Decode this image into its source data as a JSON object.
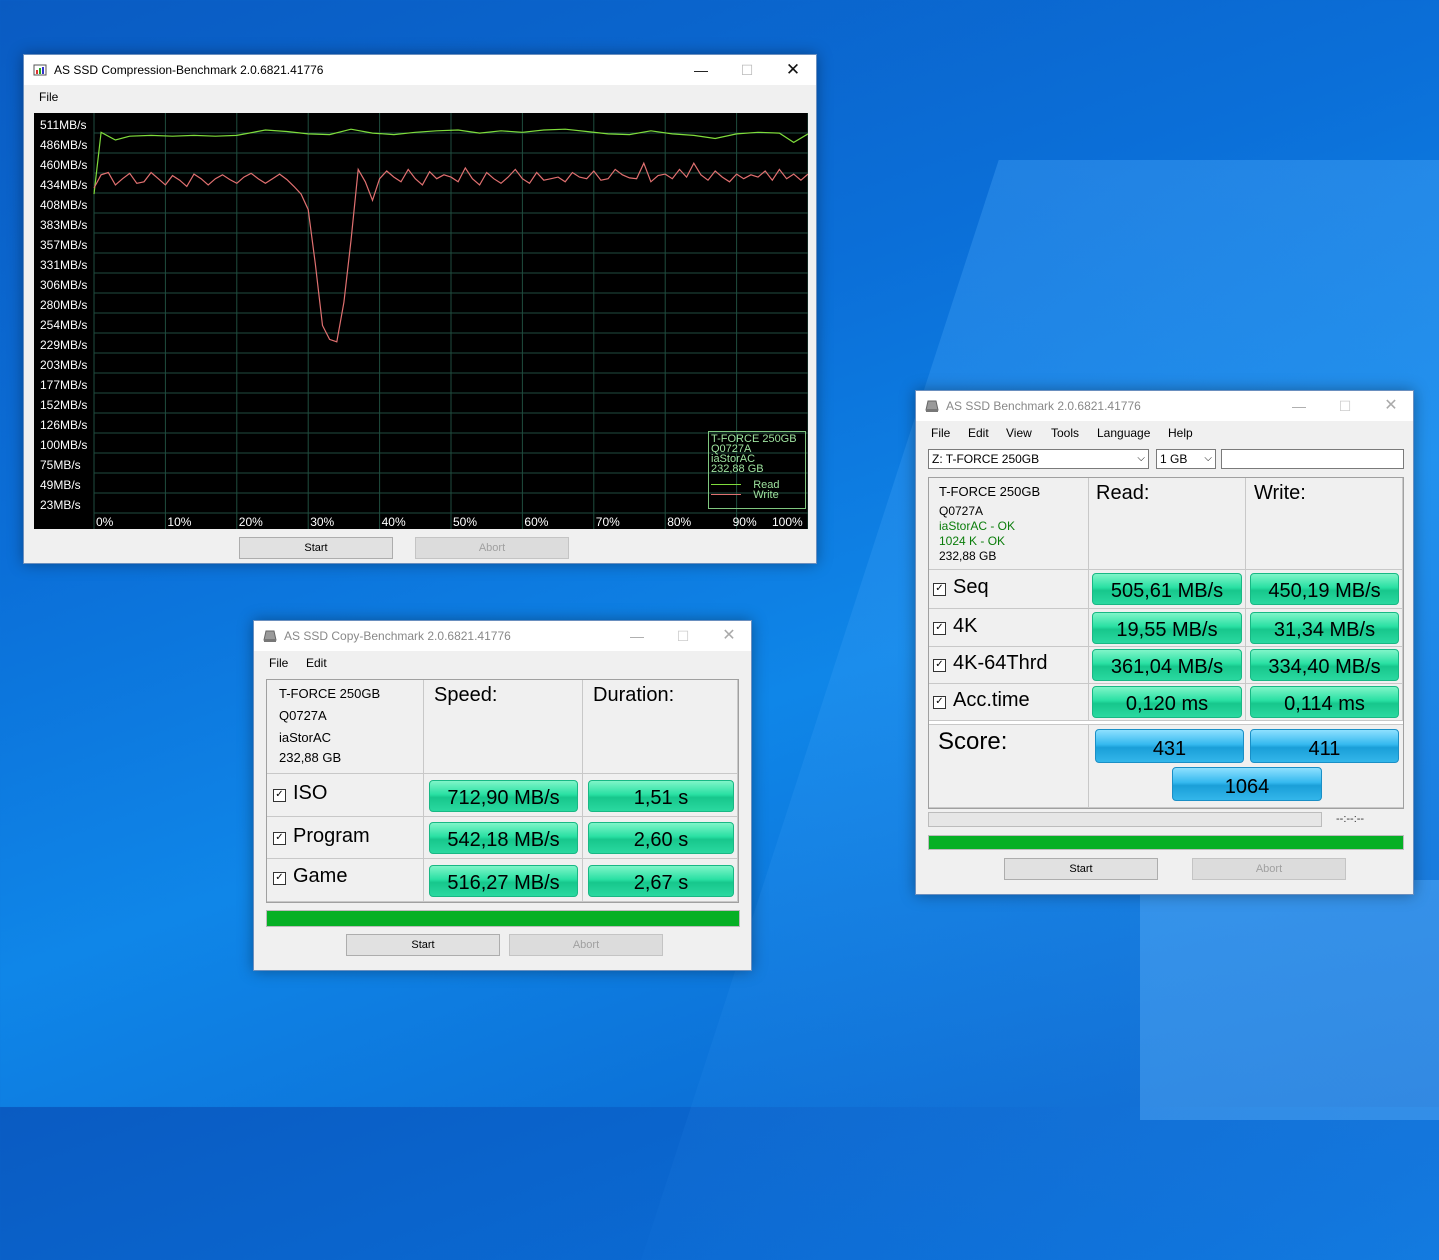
{
  "compression": {
    "title": "AS SSD Compression-Benchmark 2.0.6821.41776",
    "menu": [
      "File"
    ],
    "y_labels": [
      "511MB/s",
      "486MB/s",
      "460MB/s",
      "434MB/s",
      "408MB/s",
      "383MB/s",
      "357MB/s",
      "331MB/s",
      "306MB/s",
      "280MB/s",
      "254MB/s",
      "229MB/s",
      "203MB/s",
      "177MB/s",
      "152MB/s",
      "126MB/s",
      "100MB/s",
      "75MB/s",
      "49MB/s",
      "23MB/s"
    ],
    "x_labels": [
      "0%",
      "10%",
      "20%",
      "30%",
      "40%",
      "50%",
      "60%",
      "70%",
      "80%",
      "90%",
      "100%"
    ],
    "legend": {
      "drive": "T-FORCE 250GB",
      "firmware": "Q0727A",
      "driver": "iaStorAC",
      "size": "232,88 GB",
      "read": "Read",
      "write": "Write"
    },
    "start": "Start",
    "abort": "Abort"
  },
  "chart_data": {
    "type": "line",
    "ylim": [
      10,
      525
    ],
    "xlim": [
      0,
      100
    ],
    "grid": true,
    "legend_position": "bottom-right",
    "series": [
      {
        "name": "Read",
        "color": "#7fdc3c",
        "x": [
          0,
          1,
          3,
          5,
          8,
          11,
          14,
          17,
          20,
          24,
          27,
          30,
          33,
          36,
          39,
          42,
          45,
          48,
          51,
          54,
          57,
          60,
          63,
          66,
          69,
          72,
          75,
          78,
          81,
          84,
          87,
          90,
          93,
          96,
          98,
          100
        ],
        "y": [
          420,
          500,
          490,
          495,
          496,
          495,
          496,
          495,
          496,
          503,
          501,
          498,
          497,
          504,
          499,
          497,
          500,
          502,
          503,
          499,
          502,
          500,
          503,
          504,
          501,
          498,
          497,
          502,
          498,
          496,
          492,
          498,
          500,
          499,
          487,
          498
        ]
      },
      {
        "name": "Write",
        "color": "#e07070",
        "x": [
          0,
          1,
          2,
          3,
          4,
          5,
          6,
          7,
          8,
          9,
          10,
          11,
          12,
          13,
          14,
          15,
          16,
          17,
          18,
          19,
          20,
          21,
          22,
          23,
          24,
          25,
          26,
          27,
          28,
          29,
          30,
          31,
          32,
          33,
          34,
          35,
          36,
          37,
          38,
          39,
          40,
          41,
          42,
          43,
          44,
          45,
          46,
          47,
          48,
          49,
          50,
          51,
          52,
          53,
          54,
          55,
          56,
          57,
          58,
          59,
          60,
          61,
          62,
          63,
          64,
          65,
          66,
          67,
          68,
          69,
          70,
          71,
          72,
          73,
          74,
          75,
          76,
          77,
          78,
          79,
          80,
          81,
          82,
          83,
          84,
          85,
          86,
          87,
          88,
          89,
          90,
          91,
          92,
          93,
          94,
          95,
          96,
          97,
          98,
          99,
          100
        ],
        "y": [
          428,
          445,
          448,
          432,
          440,
          447,
          434,
          436,
          448,
          440,
          432,
          444,
          438,
          430,
          446,
          440,
          432,
          440,
          445,
          439,
          434,
          442,
          447,
          440,
          434,
          440,
          446,
          439,
          430,
          420,
          400,
          330,
          250,
          232,
          229,
          280,
          360,
          452,
          436,
          412,
          440,
          450,
          442,
          436,
          452,
          440,
          432,
          449,
          440,
          445,
          442,
          436,
          454,
          440,
          432,
          448,
          440,
          434,
          442,
          452,
          440,
          434,
          448,
          438,
          440,
          442,
          436,
          448,
          442,
          440,
          450,
          438,
          440,
          452,
          445,
          441,
          440,
          460,
          436,
          444,
          446,
          440,
          452,
          442,
          460,
          445,
          438,
          450,
          442,
          436,
          446,
          440,
          445,
          442,
          450,
          438,
          452,
          440,
          446,
          438,
          446
        ]
      }
    ]
  },
  "copy": {
    "title": "AS SSD Copy-Benchmark 2.0.6821.41776",
    "menu": [
      "File",
      "Edit"
    ],
    "drive": {
      "name": "T-FORCE 250GB",
      "firmware": "Q0727A",
      "driver": "iaStorAC",
      "size": "232,88 GB"
    },
    "headers": {
      "speed": "Speed:",
      "duration": "Duration:"
    },
    "rows": [
      {
        "label": "ISO",
        "speed": "712,90 MB/s",
        "duration": "1,51 s"
      },
      {
        "label": "Program",
        "speed": "542,18 MB/s",
        "duration": "2,60 s"
      },
      {
        "label": "Game",
        "speed": "516,27 MB/s",
        "duration": "2,67 s"
      }
    ],
    "progress": 1.0,
    "start": "Start",
    "abort": "Abort"
  },
  "bench": {
    "title": "AS SSD Benchmark 2.0.6821.41776",
    "menu": [
      "File",
      "Edit",
      "View",
      "Tools",
      "Language",
      "Help"
    ],
    "drive_select": "Z: T-FORCE 250GB",
    "size_select": "1 GB",
    "drive": {
      "name": "T-FORCE 250GB",
      "firmware": "Q0727A",
      "driver_status": "iaStorAC - OK",
      "align_status": "1024 K - OK",
      "size": "232,88 GB"
    },
    "headers": {
      "read": "Read:",
      "write": "Write:"
    },
    "rows": [
      {
        "label": "Seq",
        "read": "505,61 MB/s",
        "write": "450,19 MB/s"
      },
      {
        "label": "4K",
        "read": "19,55 MB/s",
        "write": "31,34 MB/s"
      },
      {
        "label": "4K-64Thrd",
        "read": "361,04 MB/s",
        "write": "334,40 MB/s"
      },
      {
        "label": "Acc.time",
        "read": "0,120 ms",
        "write": "0,114 ms"
      }
    ],
    "score_label": "Score:",
    "score_read": "431",
    "score_write": "411",
    "score_total": "1064",
    "time": "--:--:--",
    "progress_top": 0.0,
    "progress_bottom": 1.0,
    "start": "Start",
    "abort": "Abort"
  }
}
